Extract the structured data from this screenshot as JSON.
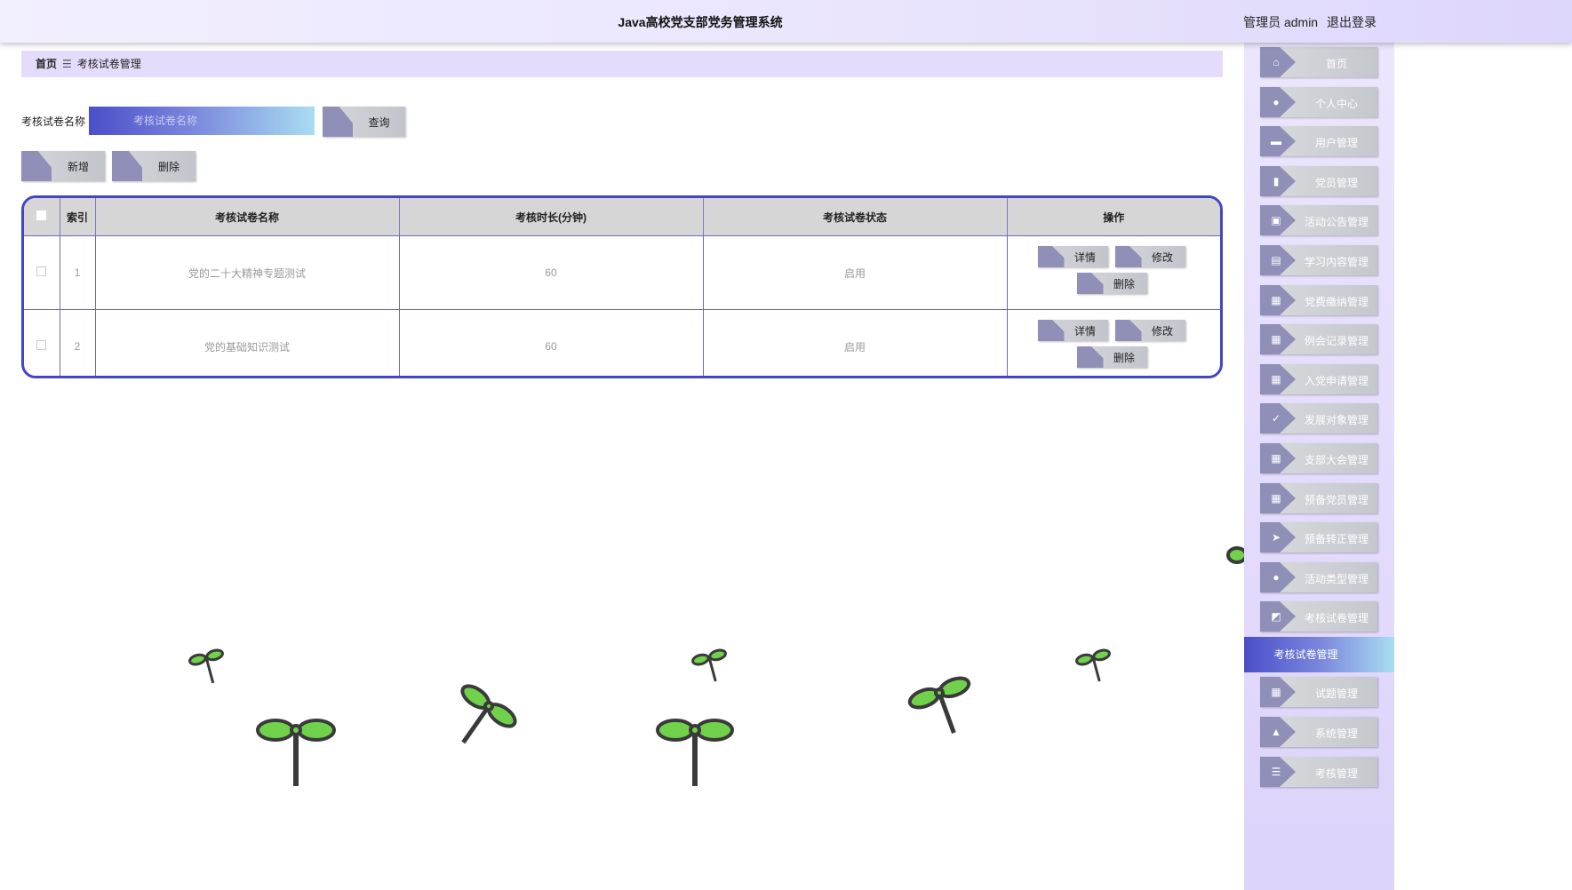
{
  "header": {
    "title": "Java高校党支部党务管理系统",
    "user_label": "管理员 admin",
    "logout": "退出登录"
  },
  "breadcrumb": {
    "home": "首页",
    "sep": "☰",
    "current": "考核试卷管理"
  },
  "search": {
    "label": "考核试卷名称",
    "placeholder": "考核试卷名称",
    "query_btn": "查询"
  },
  "actions": {
    "add": "新增",
    "delete": "删除"
  },
  "table": {
    "headers": [
      "索引",
      "考核试卷名称",
      "考核时长(分钟)",
      "考核试卷状态",
      "操作"
    ],
    "rows": [
      {
        "index": "1",
        "name": "党的二十大精神专题测试",
        "duration": "60",
        "status": "启用"
      },
      {
        "index": "2",
        "name": "党的基础知识测试",
        "duration": "60",
        "status": "启用"
      }
    ],
    "row_ops": {
      "detail": "详情",
      "edit": "修改",
      "delete": "删除"
    }
  },
  "sidebar": {
    "items": [
      {
        "label": "首页",
        "icon": "home-icon"
      },
      {
        "label": "个人中心",
        "icon": "user-icon"
      },
      {
        "label": "用户管理",
        "icon": "monitor-icon"
      },
      {
        "label": "党员管理",
        "icon": "book-icon"
      },
      {
        "label": "活动公告管理",
        "icon": "clipboard-x-icon"
      },
      {
        "label": "学习内容管理",
        "icon": "clipboard-icon"
      },
      {
        "label": "党费缴纳管理",
        "icon": "grid-icon"
      },
      {
        "label": "例会记录管理",
        "icon": "grid-icon"
      },
      {
        "label": "入党申请管理",
        "icon": "grid-icon"
      },
      {
        "label": "发展对象管理",
        "icon": "clipboard-check-icon"
      },
      {
        "label": "支部大会管理",
        "icon": "grid-icon"
      },
      {
        "label": "预备党员管理",
        "icon": "grid-icon"
      },
      {
        "label": "预备转正管理",
        "icon": "send-icon"
      },
      {
        "label": "活动类型管理",
        "icon": "user-icon"
      },
      {
        "label": "考核试卷管理",
        "icon": "chart-icon"
      },
      {
        "label": "试题管理",
        "icon": "grid-icon"
      },
      {
        "label": "系统管理",
        "icon": "user-card-icon"
      },
      {
        "label": "考核管理",
        "icon": "list-icon"
      }
    ],
    "active_label": "考核试卷管理"
  },
  "colors": {
    "accent": "#4a4fc9",
    "table_border": "#4444c4",
    "sidebar_bg": "#ddd3fb",
    "icon_bg": "#8f8fb8"
  }
}
